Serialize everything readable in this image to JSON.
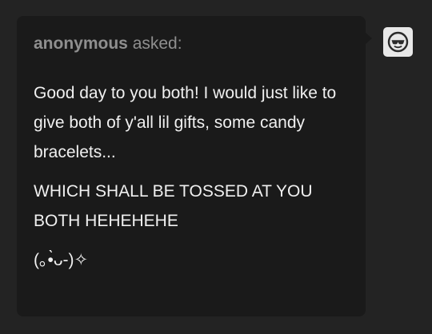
{
  "ask": {
    "asker_name": "anonymous",
    "asker_verb": "asked:",
    "paragraphs": [
      "Good day to you both! I would just like to give both of y'all lil gifts, some candy bracelets...",
      "WHICH SHALL BE TOSSED AT YOU BOTH  HEHEHEHE",
      "(｡•̀ᴗ-)✧"
    ]
  },
  "avatar": {
    "icon": "anonymous-sunglasses-face-icon"
  },
  "colors": {
    "page_background": "#232323",
    "card_background": "#1a1a1a",
    "asker_text": "#8f8f8f",
    "body_text": "#f0f0f0",
    "avatar_background": "#e8e8e8"
  }
}
